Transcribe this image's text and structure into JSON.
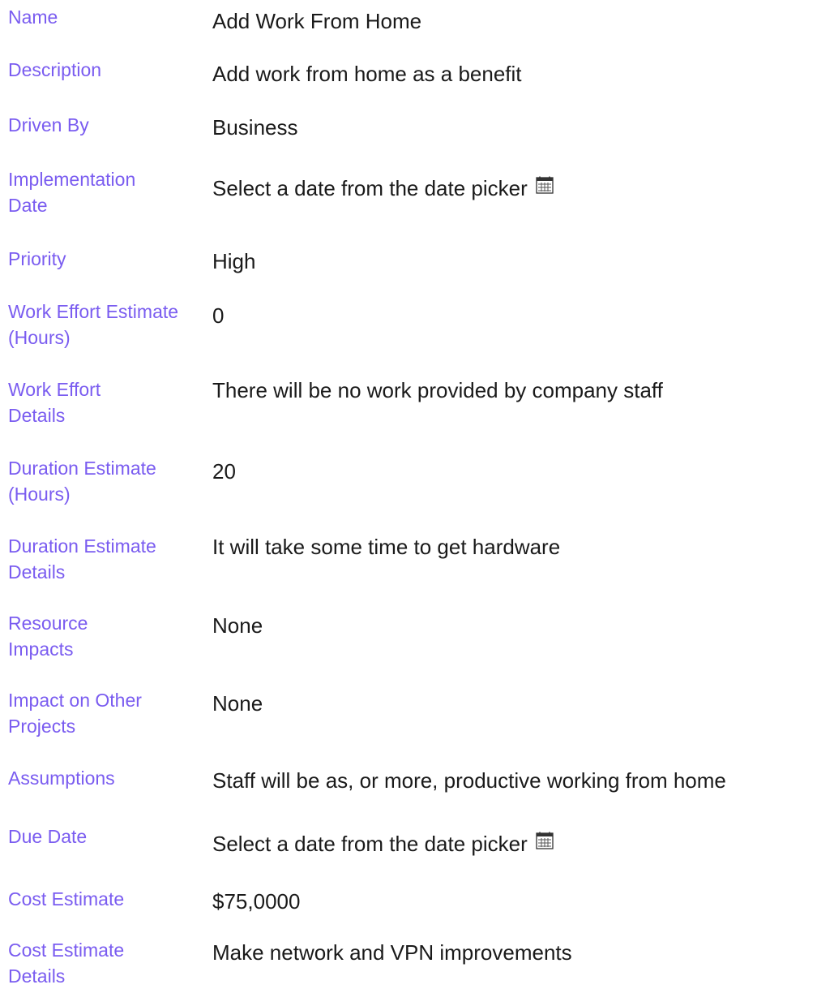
{
  "fields": [
    {
      "label": "Name",
      "value": "Add Work From Home"
    },
    {
      "label": "Description",
      "value": "Add work from home as a benefit"
    },
    {
      "label": "Driven By",
      "value": "Business"
    },
    {
      "label": "Implementation Date",
      "value": "Select a date from the date picker",
      "icon": "calendar-icon"
    },
    {
      "label": "Priority",
      "value": "High"
    },
    {
      "label": "Work Effort Estimate (Hours)",
      "value": "0"
    },
    {
      "label": "Work Effort Details",
      "value": "There will be no work provided by company staff"
    },
    {
      "label": "Duration Estimate (Hours)",
      "value": "20"
    },
    {
      "label": "Duration Estimate Details",
      "value": "It will take some time to get hardware"
    },
    {
      "label": "Resource Impacts",
      "value": "None"
    },
    {
      "label": "Impact on Other Projects",
      "value": "None"
    },
    {
      "label": "Assumptions",
      "value": "Staff will be as, or more, productive working from home"
    },
    {
      "label": "Due Date",
      "value": "Select a date from the date picker",
      "icon": "calendar-icon"
    },
    {
      "label": "Cost Estimate",
      "value": "$75,0000"
    },
    {
      "label": "Cost Estimate Details",
      "value": "Make network and VPN improvements"
    }
  ],
  "colors": {
    "label": "#7a5cf0",
    "value": "#1a1a1a",
    "background": "#ffffff"
  }
}
